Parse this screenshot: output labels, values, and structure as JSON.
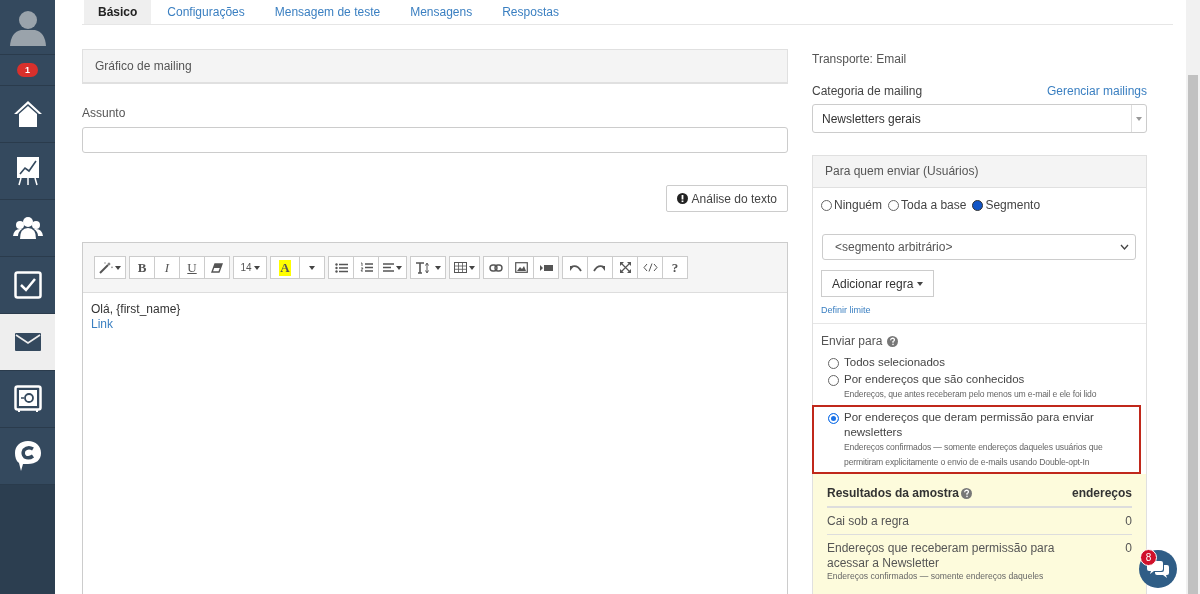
{
  "sidebar": {
    "items": [
      {
        "kind": "avatar"
      },
      {
        "kind": "badge",
        "text": "1"
      },
      {
        "kind": "home",
        "selected": false
      },
      {
        "kind": "chart",
        "selected": false
      },
      {
        "kind": "users",
        "selected": false
      },
      {
        "kind": "check",
        "selected": false
      },
      {
        "kind": "mail",
        "selected": true
      },
      {
        "kind": "safe",
        "selected": false
      },
      {
        "kind": "chat",
        "selected": false
      }
    ]
  },
  "tabs": [
    {
      "label": "Básico",
      "selected": true
    },
    {
      "label": "Configurações",
      "selected": false
    },
    {
      "label": "Mensagem de teste",
      "selected": false
    },
    {
      "label": "Mensagens",
      "selected": false
    },
    {
      "label": "Respostas",
      "selected": false
    }
  ],
  "left": {
    "section_title": "Gráfico de mailing",
    "subject_label": "Assunto",
    "analysis_button": "Análise do texto",
    "editor": {
      "toolbar": [
        [
          {
            "kind": "wand",
            "caret": true
          }
        ],
        [
          {
            "kind": "bold",
            "text": "B"
          },
          {
            "kind": "italic",
            "text": "I"
          },
          {
            "kind": "underline",
            "text": "U"
          },
          {
            "kind": "eraser"
          }
        ],
        [
          {
            "kind": "size",
            "text": "14",
            "caret": true
          }
        ],
        [
          {
            "kind": "color",
            "text": "A"
          },
          {
            "kind": "caret"
          }
        ],
        [
          {
            "kind": "ul"
          },
          {
            "kind": "ol"
          },
          {
            "kind": "align",
            "caret": true
          }
        ],
        [
          {
            "kind": "textsize",
            "caret": true
          }
        ],
        [
          {
            "kind": "table",
            "caret": true
          }
        ],
        [
          {
            "kind": "link"
          },
          {
            "kind": "image"
          },
          {
            "kind": "video"
          }
        ],
        [
          {
            "kind": "undo"
          },
          {
            "kind": "redo"
          },
          {
            "kind": "fullscreen"
          },
          {
            "kind": "code"
          },
          {
            "kind": "help",
            "text": "?"
          }
        ]
      ],
      "content": [
        {
          "kind": "text",
          "text": "Olá, {first_name}"
        },
        {
          "kind": "link",
          "text": "Link"
        }
      ]
    }
  },
  "right": {
    "transport": "Transporte: Email",
    "category_label": "Categoria de mailing",
    "manage_link": "Gerenciar mailings",
    "category_value": "Newsletters gerais",
    "panel_title": "Para quem enviar (Usuários)",
    "audience": [
      {
        "label": "Ninguém",
        "selected": false
      },
      {
        "label": "Toda a base",
        "selected": false
      },
      {
        "label": "Segmento",
        "selected": true
      }
    ],
    "segment_value": "<segmento arbitrário>",
    "add_rule_button": "Adicionar regra",
    "limit_link": "Definir limite",
    "send_to_label": "Enviar para",
    "send_options": [
      {
        "label": "Todos selecionados",
        "selected": false,
        "highlighted": false
      },
      {
        "label": "Por endereços que são conhecidos",
        "description": "Endereços, que antes receberam pelo menos um e-mail e ele foi lido",
        "selected": false,
        "highlighted": false
      },
      {
        "label": "Por endereços que deram permissão para enviar newsletters",
        "description": "Endereços confirmados — somente endereços daqueles usuários que permitiram explicitamente o envio de e-mails usando Double-opt-In",
        "selected": true,
        "highlighted": true
      }
    ],
    "results": {
      "title": "Resultados da amostra",
      "column": "endereços",
      "rows": [
        {
          "label": "Cai sob a regra",
          "value": "0"
        },
        {
          "label": "Endereços que receberam permissão para acessar a Newsletter",
          "value": "0",
          "description": "Endereços confirmados — somente endereços daqueles"
        }
      ]
    }
  },
  "chat": {
    "badge": "8"
  }
}
